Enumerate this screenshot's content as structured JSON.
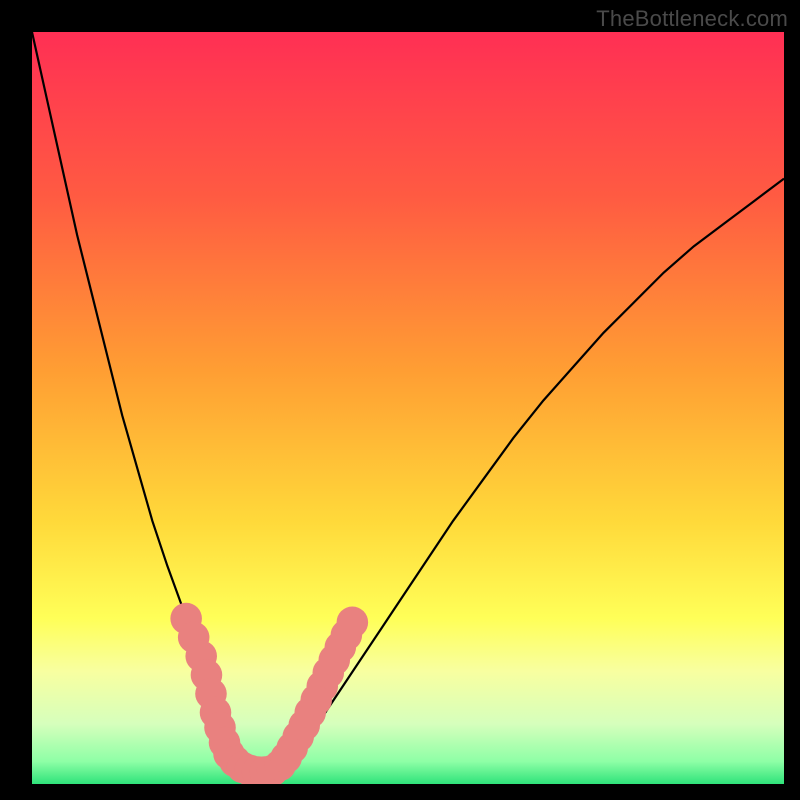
{
  "watermark": "TheBottleneck.com",
  "gradient_colors": {
    "c0": "#ff2f54",
    "c1": "#ff5b42",
    "c2": "#ff9e33",
    "c3": "#ffd93a",
    "c4": "#ffff58",
    "c5": "#f8ffa0",
    "c6": "#d6ffbc",
    "c7": "#8effa6",
    "c8": "#2fe37a"
  },
  "chart_data": {
    "type": "line",
    "title": "",
    "xlabel": "",
    "ylabel": "",
    "xlim": [
      0,
      100
    ],
    "ylim": [
      0,
      100
    ],
    "x": [
      0,
      2,
      4,
      6,
      8,
      10,
      12,
      14,
      16,
      18,
      20,
      21,
      22,
      23,
      24,
      25,
      26,
      27,
      28,
      29,
      30,
      32,
      34,
      36,
      38,
      40,
      44,
      48,
      52,
      56,
      60,
      64,
      68,
      72,
      76,
      80,
      84,
      88,
      92,
      96,
      100
    ],
    "series": [
      {
        "name": "bottleneck-curve",
        "values": [
          100,
          91,
          82,
          73,
          65,
          57,
          49,
          42,
          35,
          29,
          23.5,
          21,
          18.5,
          16,
          13,
          10,
          8,
          6,
          4.5,
          3,
          2,
          2,
          3,
          5.5,
          8,
          11,
          17,
          23,
          29,
          35,
          40.5,
          46,
          51,
          55.5,
          60,
          64,
          68,
          71.5,
          74.5,
          77.5,
          80.5
        ]
      }
    ],
    "markers": {
      "name": "highlight-points",
      "points": [
        {
          "x": 20.5,
          "y": 22
        },
        {
          "x": 21.5,
          "y": 19.5
        },
        {
          "x": 22.5,
          "y": 17
        },
        {
          "x": 23.2,
          "y": 14.5
        },
        {
          "x": 23.8,
          "y": 12
        },
        {
          "x": 24.4,
          "y": 9.5
        },
        {
          "x": 25.0,
          "y": 7.5
        },
        {
          "x": 25.6,
          "y": 5.5
        },
        {
          "x": 26.2,
          "y": 4.0
        },
        {
          "x": 27.0,
          "y": 3.0
        },
        {
          "x": 28.0,
          "y": 2.2
        },
        {
          "x": 29.0,
          "y": 1.8
        },
        {
          "x": 30.0,
          "y": 1.6
        },
        {
          "x": 31.0,
          "y": 1.6
        },
        {
          "x": 32.0,
          "y": 1.8
        },
        {
          "x": 33.0,
          "y": 2.5
        },
        {
          "x": 33.8,
          "y": 3.5
        },
        {
          "x": 34.6,
          "y": 4.8
        },
        {
          "x": 35.4,
          "y": 6.3
        },
        {
          "x": 36.2,
          "y": 7.8
        },
        {
          "x": 37.0,
          "y": 9.5
        },
        {
          "x": 37.8,
          "y": 11.2
        },
        {
          "x": 38.6,
          "y": 13.0
        },
        {
          "x": 39.4,
          "y": 14.8
        },
        {
          "x": 40.2,
          "y": 16.5
        },
        {
          "x": 41.0,
          "y": 18.2
        },
        {
          "x": 41.8,
          "y": 19.8
        },
        {
          "x": 42.6,
          "y": 21.5
        }
      ],
      "r": 1.3
    }
  }
}
